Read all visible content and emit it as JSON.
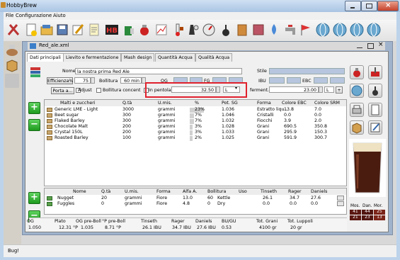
{
  "app": {
    "title": "HobbyBrew"
  },
  "menu": {
    "file": "File",
    "config": "Configurazione",
    "help": "Aiuto"
  },
  "doc": {
    "title": "Red_ale.xml"
  },
  "tabs": [
    "Dati principali",
    "Lievito e fermentazione",
    "Mash design",
    "Quantità Acqua",
    "Qualità Acqua"
  ],
  "form": {
    "nome_label": "Nome",
    "nome_value": "la nostra prima Red Ale",
    "stile_label": "Stile",
    "efficienza_label": "Efficienza%",
    "efficienza_value": "75",
    "bollitura_label": "Bollitura",
    "bollitura_value": "60 min",
    "porta_label": "Porta a...",
    "adjust_label": "Adjust",
    "bollitura_concent_label": "Bollitura concent",
    "og_label": "OG",
    "fg_label": "FG",
    "ibu_label": "IBU",
    "ebc_label": "EBC",
    "in_pentola_label": "In pentola",
    "in_pentola_value": "32.50",
    "in_pentola_unit": "L",
    "ferment_label": "ferment.",
    "ferment_value": "23.00",
    "ferment_unit": "L"
  },
  "malts": {
    "headers": [
      "Malti e zuccheri",
      "Q.tà",
      "U.mis.",
      "%",
      "Pot. SG",
      "Forma",
      "Colore EBC",
      "Colore SRM"
    ],
    "rows": [
      {
        "name": "Generic LME - Light",
        "qty": "3000",
        "unit": "grammi",
        "pct": "23%",
        "pct_value": 23,
        "pot": "1.036",
        "form": "Estratto liqu...",
        "ebc": "13.8",
        "srm": "7.0"
      },
      {
        "name": "Beet sugar",
        "qty": "300",
        "unit": "grammi",
        "pct": "7%",
        "pct_value": 7,
        "pot": "1.046",
        "form": "Cristalli",
        "ebc": "0.0",
        "srm": "0.0"
      },
      {
        "name": "Flaked Barley",
        "qty": "300",
        "unit": "grammi",
        "pct": "7%",
        "pct_value": 7,
        "pot": "1.032",
        "form": "Fiocchi",
        "ebc": "3.9",
        "srm": "2.0"
      },
      {
        "name": "Chocolate Malt",
        "qty": "200",
        "unit": "grammi",
        "pct": "3%",
        "pct_value": 3,
        "pot": "1.028",
        "form": "Grani",
        "ebc": "690.5",
        "srm": "350.8"
      },
      {
        "name": "Crystal 150L",
        "qty": "200",
        "unit": "grammi",
        "pct": "3%",
        "pct_value": 3,
        "pot": "1.033",
        "form": "Grani",
        "ebc": "295.9",
        "srm": "150.3"
      },
      {
        "name": "Roasted Barley",
        "qty": "100",
        "unit": "grammi",
        "pct": "2%",
        "pct_value": 2,
        "pot": "1.025",
        "form": "Grani",
        "ebc": "591.9",
        "srm": "300.7"
      }
    ]
  },
  "hops": {
    "headers": [
      "Nome",
      "Q.tà",
      "U.mis.",
      "Forma",
      "Alfa A.",
      "Bollitura",
      "Uso",
      "Tinseth",
      "Rager",
      "Daniels"
    ],
    "rows": [
      {
        "name": "Nugget",
        "qty": "20",
        "unit": "grammi",
        "form": "Fiore",
        "alfa": "13.0",
        "boil": "60",
        "use": "Kettle",
        "tinseth": "26.1",
        "rager": "34.7",
        "daniels": "27.6"
      },
      {
        "name": "Fuggles",
        "qty": "0",
        "unit": "grammi",
        "form": "Fiore",
        "alfa": "4.8",
        "boil": "0",
        "use": "Dry",
        "tinseth": "0.0",
        "rager": "0.0",
        "daniels": "0.0"
      }
    ]
  },
  "totals": {
    "headers": [
      "OG",
      "Plato",
      "OG pre-Boll",
      "°P pre-Boll",
      "Tinseth",
      "Rager",
      "Daniels",
      "BU/GU",
      "Tot. Grani",
      "Tot. Luppoli"
    ],
    "values": [
      "1.050",
      "12.31 °P",
      "1.035",
      "8.71 °P",
      "26.1 IBU",
      "34.7 IBU",
      "27.6 IBU",
      "0.53",
      "4100 gr",
      "20 gr"
    ]
  },
  "color_table": {
    "headers": [
      "Mos.",
      "Dan.",
      "Mor."
    ],
    "row1": [
      "41",
      "44",
      "25"
    ],
    "row2": [
      "21",
      "23",
      "13"
    ]
  },
  "status": {
    "text": "Bug!"
  },
  "colors": {
    "highlight_box": "#e0222e",
    "window_frame": "#9fb3cc",
    "title_bar": "#bcd3ea",
    "color_cell_dark": "#6b1a12",
    "color_cell_mid": "#7b2418"
  }
}
